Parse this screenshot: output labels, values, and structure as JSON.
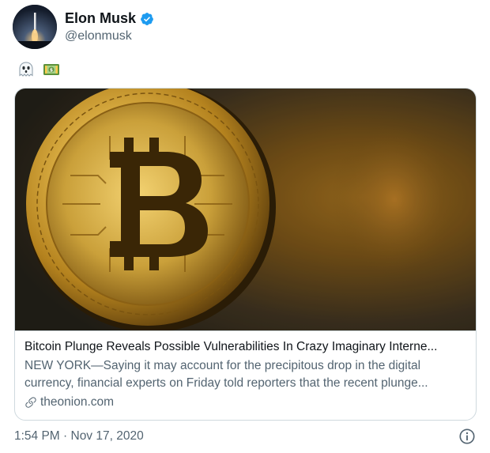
{
  "user": {
    "name": "Elon Musk",
    "handle": "@elonmusk",
    "verified": true
  },
  "tweet": {
    "emojis": [
      "ghost-emoji",
      "dollar-banknote-emoji"
    ]
  },
  "card": {
    "title": "Bitcoin Plunge Reveals Possible Vulnerabilities In Crazy Imaginary Interne...",
    "description": "NEW YORK—Saying it may account for the precipitous drop in the digital currency, financial experts on Friday told reporters that the recent plunge...",
    "domain": "theonion.com",
    "image_icon": "bitcoin-coin-image"
  },
  "meta": {
    "timestamp": "1:54 PM · Nov 17, 2020"
  },
  "colors": {
    "verified_blue": "#1d9bf0",
    "secondary_text": "#536471",
    "border": "#cfd9de"
  }
}
